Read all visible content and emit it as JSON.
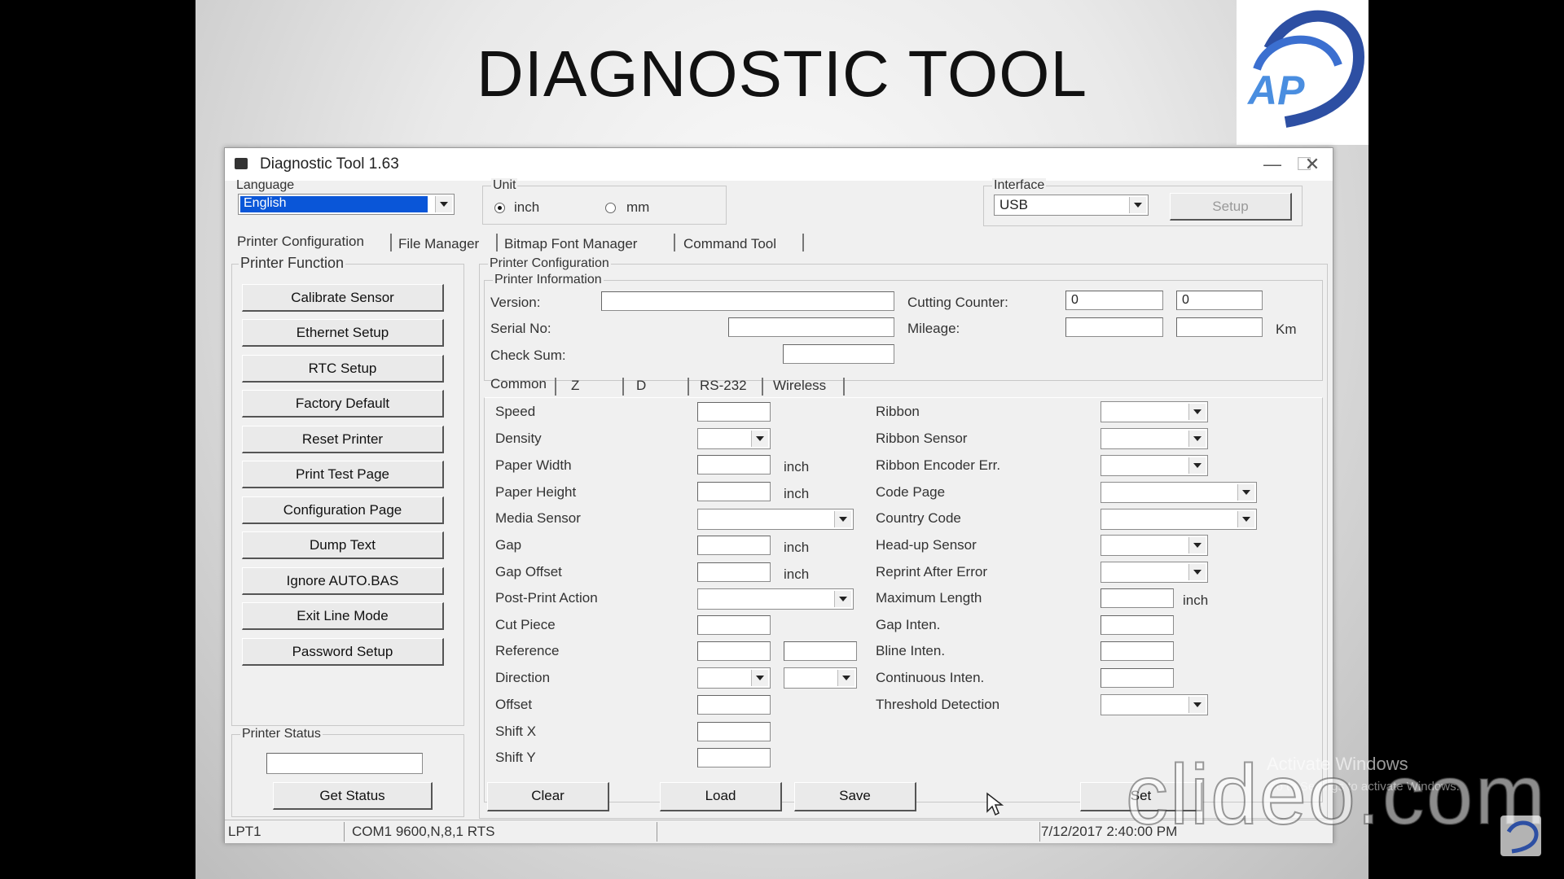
{
  "slide": {
    "title": "DIAGNOSTIC TOOL",
    "logo_text": "AP"
  },
  "window": {
    "title": "Diagnostic Tool 1.63",
    "minimize": "—",
    "maximize": "☐",
    "close": "✕"
  },
  "language": {
    "label": "Language",
    "value": "English"
  },
  "unit": {
    "label": "Unit",
    "options": [
      "inch",
      "mm"
    ],
    "selected": "inch"
  },
  "interface": {
    "label": "Interface",
    "value": "USB",
    "setup_label": "Setup"
  },
  "tabs": [
    "Printer Configuration",
    "File Manager",
    "Bitmap Font Manager",
    "Command Tool"
  ],
  "printer_function": {
    "label": "Printer Function",
    "buttons": [
      "Calibrate Sensor",
      "Ethernet Setup",
      "RTC Setup",
      "Factory Default",
      "Reset Printer",
      "Print Test Page",
      "Configuration Page",
      "Dump Text",
      "Ignore AUTO.BAS",
      "Exit Line Mode",
      "Password Setup"
    ]
  },
  "printer_status": {
    "label": "Printer Status",
    "value": "",
    "get_status_label": "Get Status"
  },
  "printer_configuration": {
    "label": "Printer Configuration",
    "info_label": "Printer Information",
    "version_label": "Version:",
    "serial_label": "Serial No:",
    "checksum_label": "Check Sum:",
    "cutting_counter_label": "Cutting Counter:",
    "cutting_counter_values": [
      "0",
      "0"
    ],
    "mileage_label": "Mileage:",
    "mileage_unit": "Km"
  },
  "sub_tabs": [
    "Common",
    "Z",
    "D",
    "RS-232",
    "Wireless"
  ],
  "common_left": [
    "Speed",
    "Density",
    "Paper Width",
    "Paper Height",
    "Media Sensor",
    "Gap",
    "Gap Offset",
    "Post-Print Action",
    "Cut Piece",
    "Reference",
    "Direction",
    "Offset",
    "Shift X",
    "Shift Y"
  ],
  "common_right": [
    "Ribbon",
    "Ribbon Sensor",
    "Ribbon Encoder Err.",
    "Code Page",
    "Country Code",
    "Head-up Sensor",
    "Reprint After Error",
    "Maximum Length",
    "Gap Inten.",
    "Bline Inten.",
    "Continuous Inten.",
    "Threshold Detection"
  ],
  "unit_inch": "inch",
  "actions": [
    "Clear",
    "Load",
    "Save",
    "Set"
  ],
  "statusbar": {
    "port": "LPT1",
    "com": "COM1 9600,N,8,1 RTS",
    "datetime": "7/12/2017 2:40:00 PM"
  },
  "overlay": {
    "watermark": "clideo.com",
    "activate": "Activate Windows",
    "activate_sub": "Go to Settings to activate Windows."
  }
}
